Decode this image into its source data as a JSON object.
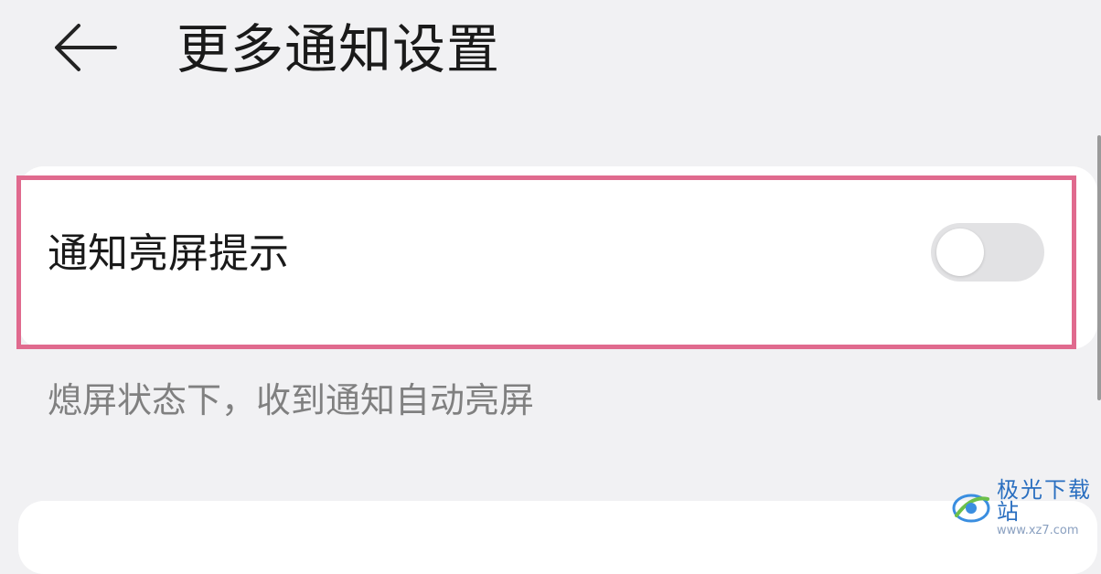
{
  "header": {
    "back_icon": "arrow-left-icon",
    "title": "更多通知设置"
  },
  "setting": {
    "label": "通知亮屏提示",
    "enabled": false,
    "description": "熄屏状态下，收到通知自动亮屏"
  },
  "watermark": {
    "name": "极光下载站",
    "url": "www.xz7.com",
    "logo_icon": "xz7-logo-icon"
  },
  "colors": {
    "background": "#f1f1f3",
    "card": "#ffffff",
    "highlight": "#e06a8e",
    "toggle_off": "#e2e2e4",
    "description_text": "#808080"
  }
}
